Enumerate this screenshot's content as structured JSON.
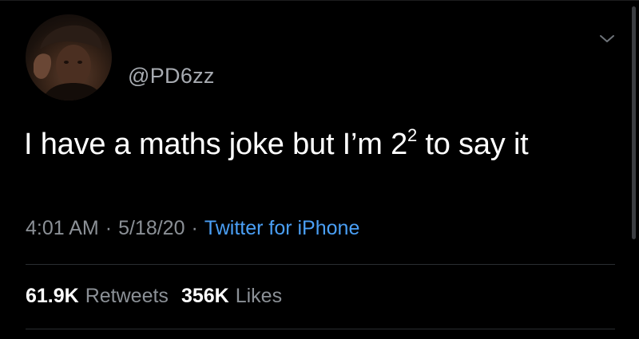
{
  "user": {
    "handle": "@PD6zz",
    "avatar_icon": "user-avatar-photo"
  },
  "tweet": {
    "text_before": "I have a maths joke but I’m 2",
    "superscript": "2",
    "text_after": " to say it"
  },
  "meta": {
    "time": "4:01 AM",
    "separator": "·",
    "date": "5/18/20",
    "source": "Twitter for iPhone"
  },
  "stats": {
    "retweets_count": "61.9K",
    "retweets_label": "Retweets",
    "likes_count": "356K",
    "likes_label": "Likes"
  },
  "icons": {
    "more": "chevron-down-icon"
  },
  "colors": {
    "background": "#000000",
    "text": "#ffffff",
    "secondary_text": "#8b9096",
    "link": "#4a9ff5"
  }
}
